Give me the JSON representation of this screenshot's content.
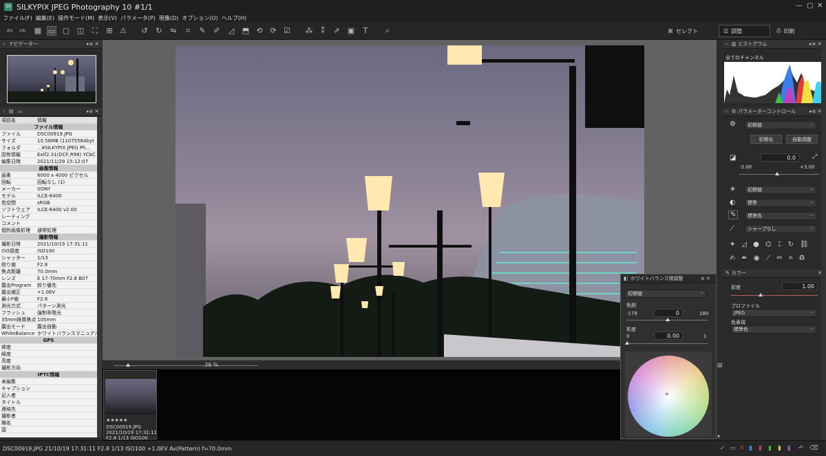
{
  "window": {
    "title": "SILKYPIX JPEG Photography 10   #1/1",
    "app_icon": "10"
  },
  "menu": [
    "ファイル(F)",
    "編集(E)",
    "操作モード(M)",
    "表示(V)",
    "パラメータ(P)",
    "現像(D)",
    "オプション(O)",
    "ヘルプ(H)"
  ],
  "toolbar": {
    "select_label": "セレクト",
    "adjust_label": "調整",
    "print_label": "印刷"
  },
  "navigator": {
    "title": "ナビゲーター"
  },
  "info": {
    "col_key": "項目名",
    "col_value": "情報",
    "sections": {
      "file": "ファイル情報",
      "image": "画像情報",
      "shoot": "撮影情報",
      "gps": "GPS",
      "iptc": "IPTC情報"
    },
    "file_rows": [
      [
        "ファイル",
        "DSC00919.JPG"
      ],
      [
        "サイズ",
        "10.56MB (11075584byt"
      ],
      [
        "フォルダ",
        "...¥SILKYPIX JPEG Ph..."
      ],
      [
        "固有情報",
        "Exif2.31(DCF,R98) YCbC"
      ],
      [
        "編集日時",
        "2021/11/29 15:12:07"
      ]
    ],
    "image_rows": [
      [
        "画素",
        "6000 x 4000 ピクセル"
      ],
      [
        "回転",
        "回転なし (1)"
      ],
      [
        "メーカー",
        "SONY"
      ],
      [
        "モデル",
        "ILCE-6400"
      ],
      [
        "色空間",
        "sRGB"
      ],
      [
        "ソフトウェア",
        "ILCE-6400 v2.00"
      ],
      [
        "レーティング",
        ""
      ],
      [
        "コメント",
        ""
      ],
      [
        "個別画像処理",
        "通常処理"
      ]
    ],
    "shoot_rows": [
      [
        "撮影日時",
        "2021/10/19 17:31:11"
      ],
      [
        "ISO感度",
        "ISO100"
      ],
      [
        "シャッター",
        "1/13"
      ],
      [
        "絞り値",
        "F2.8"
      ],
      [
        "焦点距離",
        "70.0mm"
      ],
      [
        "レンズ",
        "E 17-70mm F2.8 B07"
      ],
      [
        "露出Program",
        "絞り優先"
      ],
      [
        "露出補正",
        "+1.0EV"
      ],
      [
        "最小F値",
        "F2.8"
      ],
      [
        "測光方式",
        "パターン測光"
      ],
      [
        "フラッシュ",
        "強制非発光"
      ],
      [
        "35mm換算焦点",
        "105mm"
      ],
      [
        "露出モード",
        "露出自動"
      ],
      [
        "WhiteBalance",
        "ホワイトバランスマニュアル"
      ]
    ],
    "gps_rows": [
      [
        "緯度",
        ""
      ],
      [
        "経度",
        ""
      ],
      [
        "高度",
        ""
      ],
      [
        "撮影方向",
        ""
      ]
    ],
    "iptc_rows": [
      [
        "未編集",
        ""
      ],
      [
        "キャプション",
        ""
      ],
      [
        "記入者",
        ""
      ],
      [
        "タイトル",
        ""
      ],
      [
        "連絡先",
        ""
      ],
      [
        "撮影者",
        ""
      ],
      [
        "職名",
        ""
      ],
      [
        "国",
        ""
      ]
    ]
  },
  "viewer": {
    "zoom": "36 %"
  },
  "filmstrip": {
    "filename": "DSC00919.JPG",
    "datetime": "2021/10/19 17:31:11",
    "exposure": "F2.8 1/13 ISO100",
    "rating_stars": "★★★★★"
  },
  "wb_panel": {
    "title": "ホワイトバランス微調整",
    "preset": "初期値",
    "hue_label": "色相",
    "hue_min": "-179",
    "hue_value": "0",
    "hue_max": "180",
    "sat_label": "彩度",
    "sat_min": "0",
    "sat_value": "0.00",
    "sat_max": "1"
  },
  "histogram": {
    "title": "ヒストグラム",
    "channel": "全てのチャンネル"
  },
  "param": {
    "title": "パラメーターコントロール",
    "preset": "初期値",
    "reset_button": "初期化",
    "auto_button": "自動調整",
    "exposure_value": "0.0",
    "exposure_min": "-3.00",
    "exposure_max": "+3.00",
    "wb_select": "初期値",
    "contrast_select": "標準",
    "color_select": "標準色",
    "sharp_select": "シャープなし"
  },
  "color": {
    "title": "カラー",
    "saturation_label": "彩度",
    "saturation_value": "1.00",
    "profile_label": "プロファイル",
    "profile_value": "JPEG",
    "colorspace_label": "色表現",
    "colorspace_value": "標準色"
  },
  "status": {
    "text": "DSC00919.JPG 21/10/19 17:31:11 F2.8 1/13 ISO100 +1.0EV Av(Pattern) f=70.0mm"
  }
}
